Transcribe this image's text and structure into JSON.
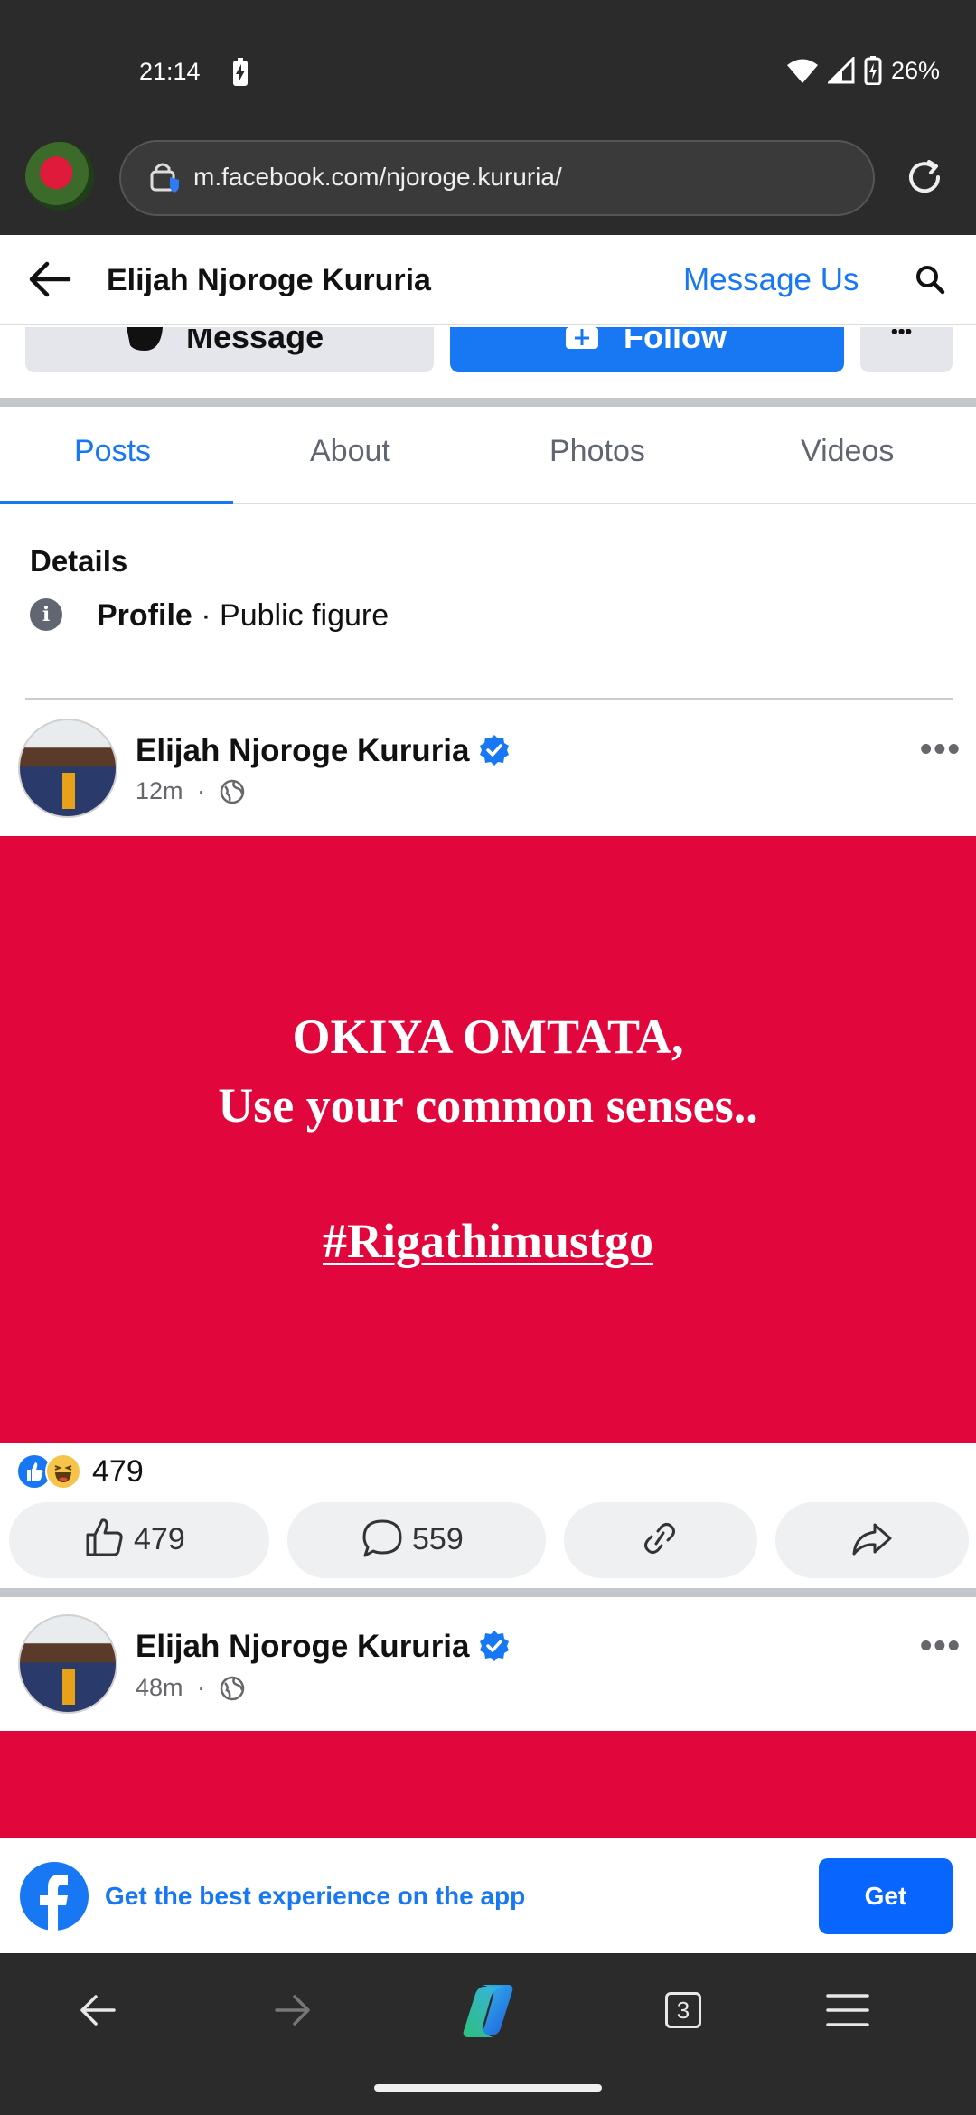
{
  "status_bar": {
    "time": "21:14",
    "battery": "26%"
  },
  "browser": {
    "url": "m.facebook.com/njoroge.kururia/",
    "tab_count": "3"
  },
  "header": {
    "page_name": "Elijah Njoroge Kururia",
    "message_us": "Message Us"
  },
  "profile_buttons": {
    "message": "Message",
    "follow": "Follow",
    "more": "•••"
  },
  "tabs": [
    {
      "label": "Posts",
      "active": true
    },
    {
      "label": "About"
    },
    {
      "label": "Photos"
    },
    {
      "label": "Videos"
    }
  ],
  "details": {
    "title": "Details",
    "label": "Profile",
    "value": "· Public figure"
  },
  "posts": [
    {
      "author": "Elijah Njoroge Kururia",
      "time": "12m",
      "sep": "·",
      "image_text": {
        "line1": "OKIYA OMTATA,",
        "line2": "Use your common senses..",
        "hashtag": "#Rigathimustgo"
      },
      "reaction_total": "479",
      "likes": "479",
      "comments": "559"
    },
    {
      "author": "Elijah Njoroge Kururia",
      "time": "48m",
      "sep": "·"
    }
  ],
  "app_banner": {
    "text": "Get the best experience on the app",
    "button": "Get"
  },
  "colors": {
    "brand": "#1877f2",
    "post_bg": "#e1063c",
    "chrome": "#2b2b2b"
  }
}
